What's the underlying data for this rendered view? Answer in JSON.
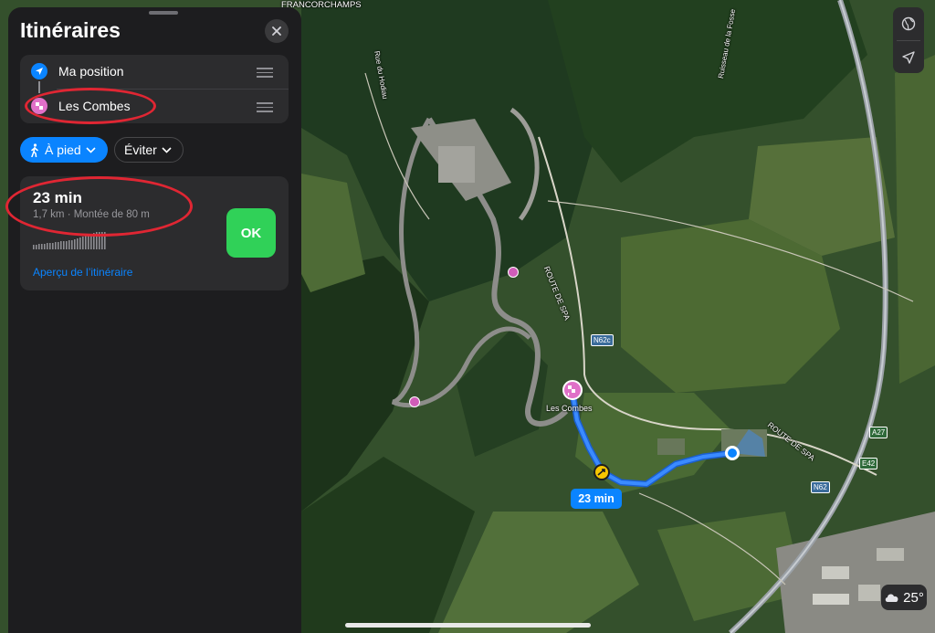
{
  "panel": {
    "title": "Itinéraires",
    "stops": [
      {
        "label": "Ma position",
        "color": "#0a84ff",
        "icon": "location-arrow-icon"
      },
      {
        "label": "Les Combes",
        "color": "#e070c8",
        "icon": "racing-flag-icon"
      }
    ],
    "mode_label": "À pied",
    "mode_icon": "walking-person-icon",
    "avoid_label": "Éviter",
    "route": {
      "duration": "23 min",
      "details": "1,7 km · Montée de 80 m",
      "ok_label": "OK",
      "overview_link": "Aperçu de l’itinéraire"
    }
  },
  "map": {
    "labels": {
      "francorchamps": "FRANCORCHAMPS",
      "les_combes": "Les Combes",
      "route_de_spa_1": "ROUTE DE SPA",
      "route_de_spa_2": "ROUTE DE SPA",
      "ruisseau": "Ruisseau de la Fosse",
      "rue_du_hodiau": "Rue du Hodiau"
    },
    "shields": {
      "n62c": "N62c",
      "a27": "A27",
      "e42": "E42",
      "n62": "N62"
    },
    "route_badge": "23 min",
    "weather": "25°",
    "colors": {
      "route": "#2f7cf6",
      "accent": "#0a84ff",
      "annotation": "#e02633"
    }
  }
}
